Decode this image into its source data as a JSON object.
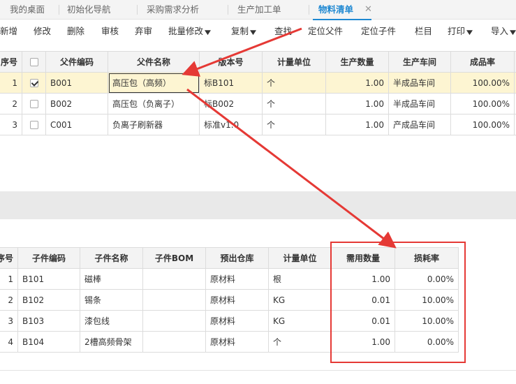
{
  "tabs": [
    {
      "label": "我的桌面",
      "active": false
    },
    {
      "label": "初始化导航",
      "active": false
    },
    {
      "label": "采购需求分析",
      "active": false
    },
    {
      "label": "生产加工单",
      "active": false
    },
    {
      "label": "物料清单",
      "active": true
    }
  ],
  "tab_close_glyph": "✕",
  "toolbar": [
    {
      "label": "新增",
      "dropdown": false
    },
    {
      "label": "修改",
      "dropdown": false
    },
    {
      "label": "删除",
      "dropdown": false
    },
    {
      "label": "审核",
      "dropdown": false
    },
    {
      "label": "弃审",
      "dropdown": false
    },
    {
      "label": "批量修改",
      "dropdown": true
    },
    {
      "label": "复制",
      "dropdown": true
    },
    {
      "label": "查找",
      "dropdown": false
    },
    {
      "label": "定位父件",
      "dropdown": false
    },
    {
      "label": "定位子件",
      "dropdown": false
    },
    {
      "label": "栏目",
      "dropdown": false
    },
    {
      "label": "打印",
      "dropdown": true
    },
    {
      "label": "导入",
      "dropdown": true
    }
  ],
  "parent_table": {
    "headers": [
      "序号",
      "",
      "父件编码",
      "父件名称",
      "版本号",
      "计量单位",
      "生产数量",
      "生产车间",
      "成品率"
    ],
    "rows": [
      {
        "index": "1",
        "checked": true,
        "code": "B001",
        "name": "高压包（高频）",
        "version": "标B101",
        "unit": "个",
        "qty": "1.00",
        "workshop": "半成品车间",
        "yield": "100.00%"
      },
      {
        "index": "2",
        "checked": false,
        "code": "B002",
        "name": "高压包（负离子）",
        "version": "标B002",
        "unit": "个",
        "qty": "1.00",
        "workshop": "半成品车间",
        "yield": "100.00%"
      },
      {
        "index": "3",
        "checked": false,
        "code": "C001",
        "name": "负离子刷新器",
        "version": "标准v1.0",
        "unit": "个",
        "qty": "1.00",
        "workshop": "产成品车间",
        "yield": "100.00%"
      }
    ]
  },
  "child_table": {
    "headers": [
      "序号",
      "子件编码",
      "子件名称",
      "子件BOM",
      "预出仓库",
      "计量单位",
      "需用数量",
      "损耗率"
    ],
    "rows": [
      {
        "index": "1",
        "code": "B101",
        "name": "磁棒",
        "bom": "",
        "warehouse": "原材料",
        "unit": "根",
        "qty": "1.00",
        "loss": "0.00%"
      },
      {
        "index": "2",
        "code": "B102",
        "name": "锡条",
        "bom": "",
        "warehouse": "原材料",
        "unit": "KG",
        "qty": "0.01",
        "loss": "10.00%"
      },
      {
        "index": "3",
        "code": "B103",
        "name": "漆包线",
        "bom": "",
        "warehouse": "原材料",
        "unit": "KG",
        "qty": "0.01",
        "loss": "10.00%"
      },
      {
        "index": "4",
        "code": "B104",
        "name": "2槽高频骨架",
        "bom": "",
        "warehouse": "原材料",
        "unit": "个",
        "qty": "1.00",
        "loss": "0.00%"
      }
    ]
  },
  "colors": {
    "accent": "#1e88d2",
    "selected_row": "#fdf5d2",
    "annotation": "#e53935"
  }
}
